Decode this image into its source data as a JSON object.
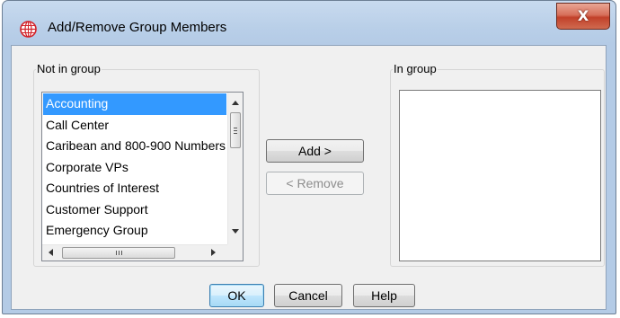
{
  "window": {
    "title": "Add/Remove Group Members",
    "close_label": "X",
    "icon": "globe-app-icon"
  },
  "not_in_group": {
    "legend": "Not in group",
    "items": [
      "Accounting",
      "Call Center",
      "Caribean and 800-900 Numbers",
      "Corporate VPs",
      "Countries of Interest",
      "Customer Support",
      "Emergency Group"
    ],
    "selected_index": 0,
    "horizontal_scroll_grip": "III"
  },
  "in_group": {
    "legend": "In group",
    "items": []
  },
  "buttons": {
    "add": "Add >",
    "remove": "< Remove",
    "ok": "OK",
    "cancel": "Cancel",
    "help": "Help"
  },
  "colors": {
    "selection": "#3399ff",
    "close_button": "#c2412a",
    "title_bar": "#b9cfe8",
    "icon_red": "#d2232a"
  }
}
